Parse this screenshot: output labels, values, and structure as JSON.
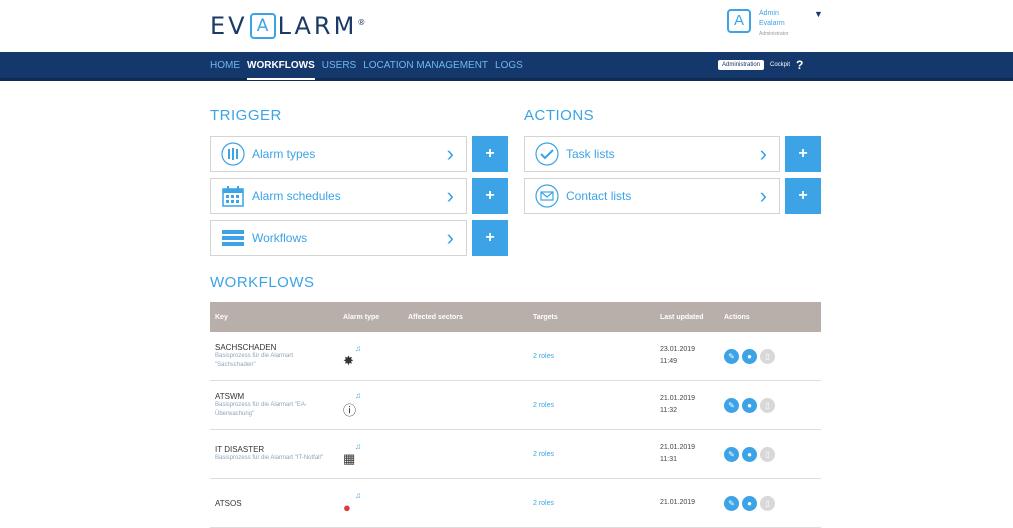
{
  "brand": {
    "logo_left": "EV",
    "logo_mid": "A",
    "logo_right": "LARM",
    "reg": "®"
  },
  "user": {
    "name": "Admin",
    "org": "Evalarm",
    "role": "Administrator"
  },
  "nav": {
    "items": [
      "HOME",
      "WORKFLOWS",
      "USERS",
      "LOCATION MANAGEMENT",
      "LOGS"
    ],
    "active": 1,
    "administration": "Administration",
    "cockpit": "Cockpit",
    "help": "?"
  },
  "trigger": {
    "title": "TRIGGER",
    "items": [
      "Alarm types",
      "Alarm schedules",
      "Workflows"
    ]
  },
  "actions": {
    "title": "ACTIONS",
    "items": [
      "Task lists",
      "Contact lists"
    ]
  },
  "plus_label": "+",
  "chevron": "›",
  "workflows": {
    "title": "WORKFLOWS",
    "columns": [
      "Key",
      "Alarm type",
      "Affected sectors",
      "Targets",
      "Last updated",
      "Actions"
    ],
    "rows": [
      {
        "key": "SACHSCHADEN",
        "desc": "Basisprozess für die Alarmart \"Sachschaden\"",
        "icon": "burst-icon",
        "targets": "2 roles",
        "date": "23.01.2019",
        "time": "11:49"
      },
      {
        "key": "ATSWM",
        "desc": "Basisprozess für die Alarmart \"EA-Überwachung\"",
        "icon": "info-icon",
        "targets": "2 roles",
        "date": "21.01.2019",
        "time": "11:32"
      },
      {
        "key": "IT DISASTER",
        "desc": "Basisprozess für die Alarmart \"IT-Notfall\"",
        "icon": "server-icon",
        "targets": "2 roles",
        "date": "21.01.2019",
        "time": "11:31"
      },
      {
        "key": "ATSOS",
        "desc": "",
        "icon": "sos-icon",
        "targets": "2 roles",
        "date": "21.01.2019",
        "time": ""
      }
    ]
  },
  "colors": {
    "accent": "#3ba3e6",
    "navbar": "#14386b",
    "table_header": "#b8afaa"
  }
}
